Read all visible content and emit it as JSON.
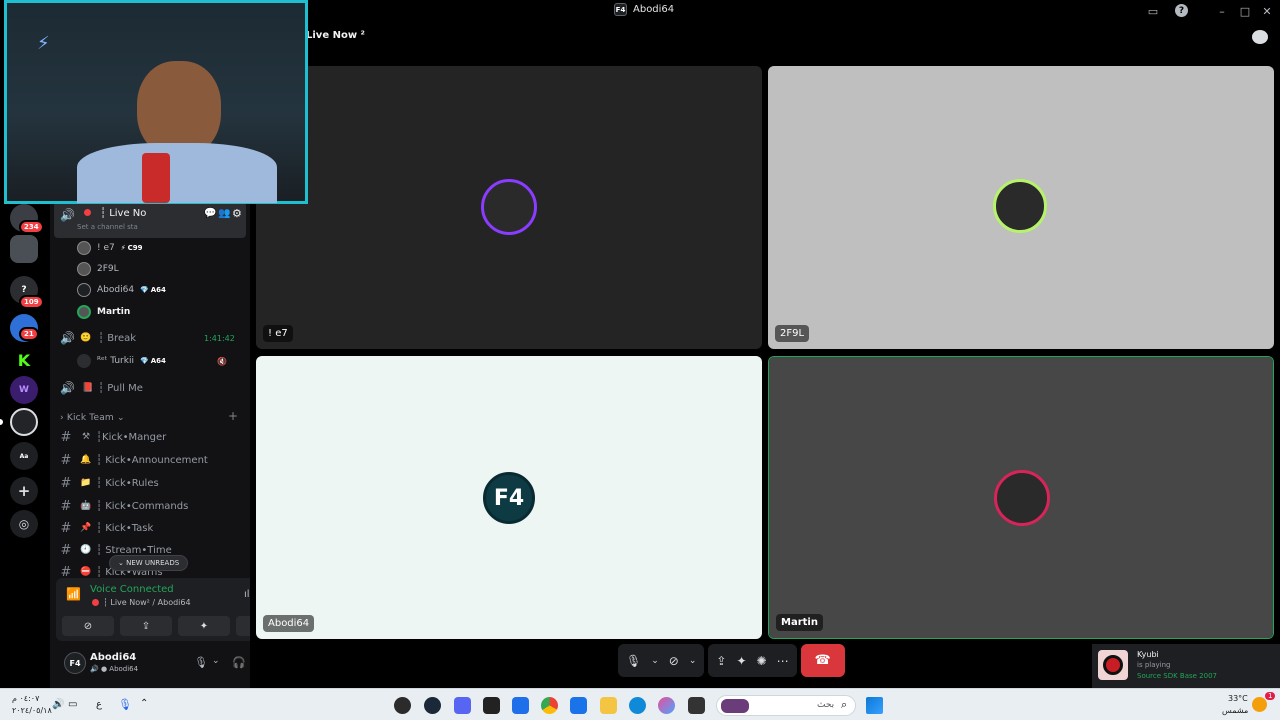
{
  "window": {
    "title": "Abodi64",
    "logo_text": "F4"
  },
  "stage": {
    "channel_title": "Live Now ²"
  },
  "rail": {
    "badges": [
      "234",
      "109",
      "21"
    ]
  },
  "sidebar": {
    "active_voice": {
      "name": "┆ Live No",
      "status_placeholder": "Set a channel sta"
    },
    "members": [
      {
        "name": "! e7",
        "tag": "C99"
      },
      {
        "name": "2F9L",
        "tag": ""
      },
      {
        "name": "Abodi64",
        "tag": "A64"
      },
      {
        "name": "Martin",
        "tag": ""
      }
    ],
    "break_channel": {
      "name": "┆ Break",
      "timer": "1:41:42"
    },
    "break_member": {
      "name": "ᴿᵉᵗ Turkii",
      "tag": "A64"
    },
    "pull_channel": {
      "name": "┆ Pull Me"
    },
    "category": "Kick Team",
    "text_channels": [
      {
        "emoji": "⚒",
        "label": "┆Kick•Manger"
      },
      {
        "emoji": "🔔",
        "label": "┆ Kick•Announcement"
      },
      {
        "emoji": "📁",
        "label": "┆ Kick•Rules"
      },
      {
        "emoji": "🤖",
        "label": "┆ Kick•Commands"
      },
      {
        "emoji": "📌",
        "label": "┆ Kick•Task"
      },
      {
        "emoji": "🕘",
        "label": "┆ Stream•Time"
      },
      {
        "emoji": "⛔",
        "label": "┆ Kick•Warns"
      }
    ],
    "new_unreads": "NEW UNREADS"
  },
  "voice_panel": {
    "status": "Voice Connected",
    "channel": "┆ Live Now² / Abodi64"
  },
  "user_panel": {
    "name": "Abodi64",
    "sub": "Abodi64"
  },
  "tiles": [
    {
      "name": "! e7",
      "bg": "#242424",
      "ring": "#8a3cff"
    },
    {
      "name": "2F9L",
      "bg": "#bfbfbf",
      "ring": "#b6f36b"
    },
    {
      "name": "Abodi64",
      "bg": "#eef6f4",
      "ring": "#0e3a44"
    },
    {
      "name": "Martin",
      "bg": "#474747",
      "ring": "#d8245b"
    }
  ],
  "activity": {
    "user": "Kyubi",
    "verb": "is playing",
    "game": "Source SDK Base 2007"
  },
  "taskbar": {
    "search_placeholder": "بحث",
    "weather_temp": "33°C",
    "weather_desc": "مشمس",
    "time": "٠٤:٠٧ م",
    "date": "٢٠٢٤/٠٥/١٨",
    "lang": "ع",
    "notif_badge": "1"
  },
  "colors": {
    "accent_green": "#23a55a",
    "danger": "#da373c",
    "webcam_border": "#1fbfd0"
  }
}
